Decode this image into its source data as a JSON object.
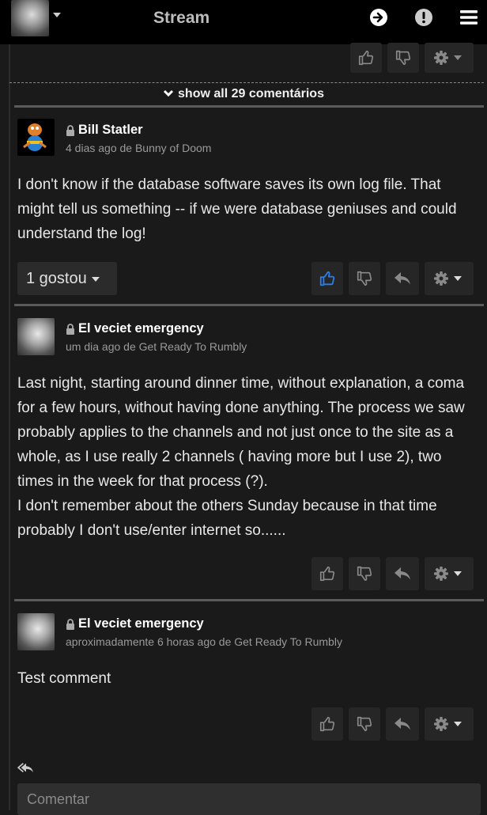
{
  "header": {
    "title": "Stream",
    "icons": [
      "avatar",
      "caret-down-icon",
      "arrow-right-circle-icon",
      "alert-circle-icon",
      "menu-icon"
    ]
  },
  "thread": {
    "show_all_label": "show all 29 comentários"
  },
  "comments": [
    {
      "author": "Bill Statler",
      "meta": "4 dias ago de Bunny of Doom",
      "text": "I don't know if the database software saves its own log file. That might tell us something -- if we were database geniuses and could understand the log!",
      "likes_label": "1 gostou"
    },
    {
      "author": "El veciet emergency",
      "meta": "um dia ago de Get Ready To Rumbly",
      "text": "Last night, starting around dinner time, without explanation,  a coma for a few hours, without having done anything. The process we saw probably applies to the channels and not just once to the site as a whole, as I use really 2 channels ( having more but I use 2), two times in the week for that process (?).\nI don't remember about the others Sunday because in that time probably I don't use/enter internet so......"
    },
    {
      "author": "El veciet emergency",
      "meta": "aproximadamente 6 horas ago de Get Ready To Rumbly",
      "text": "Test comment"
    }
  ],
  "composer": {
    "placeholder": "Comentar"
  },
  "colors": {
    "liked_accent": "#2b7de9",
    "background": "#1a1a1a",
    "topbar": "#000000"
  }
}
